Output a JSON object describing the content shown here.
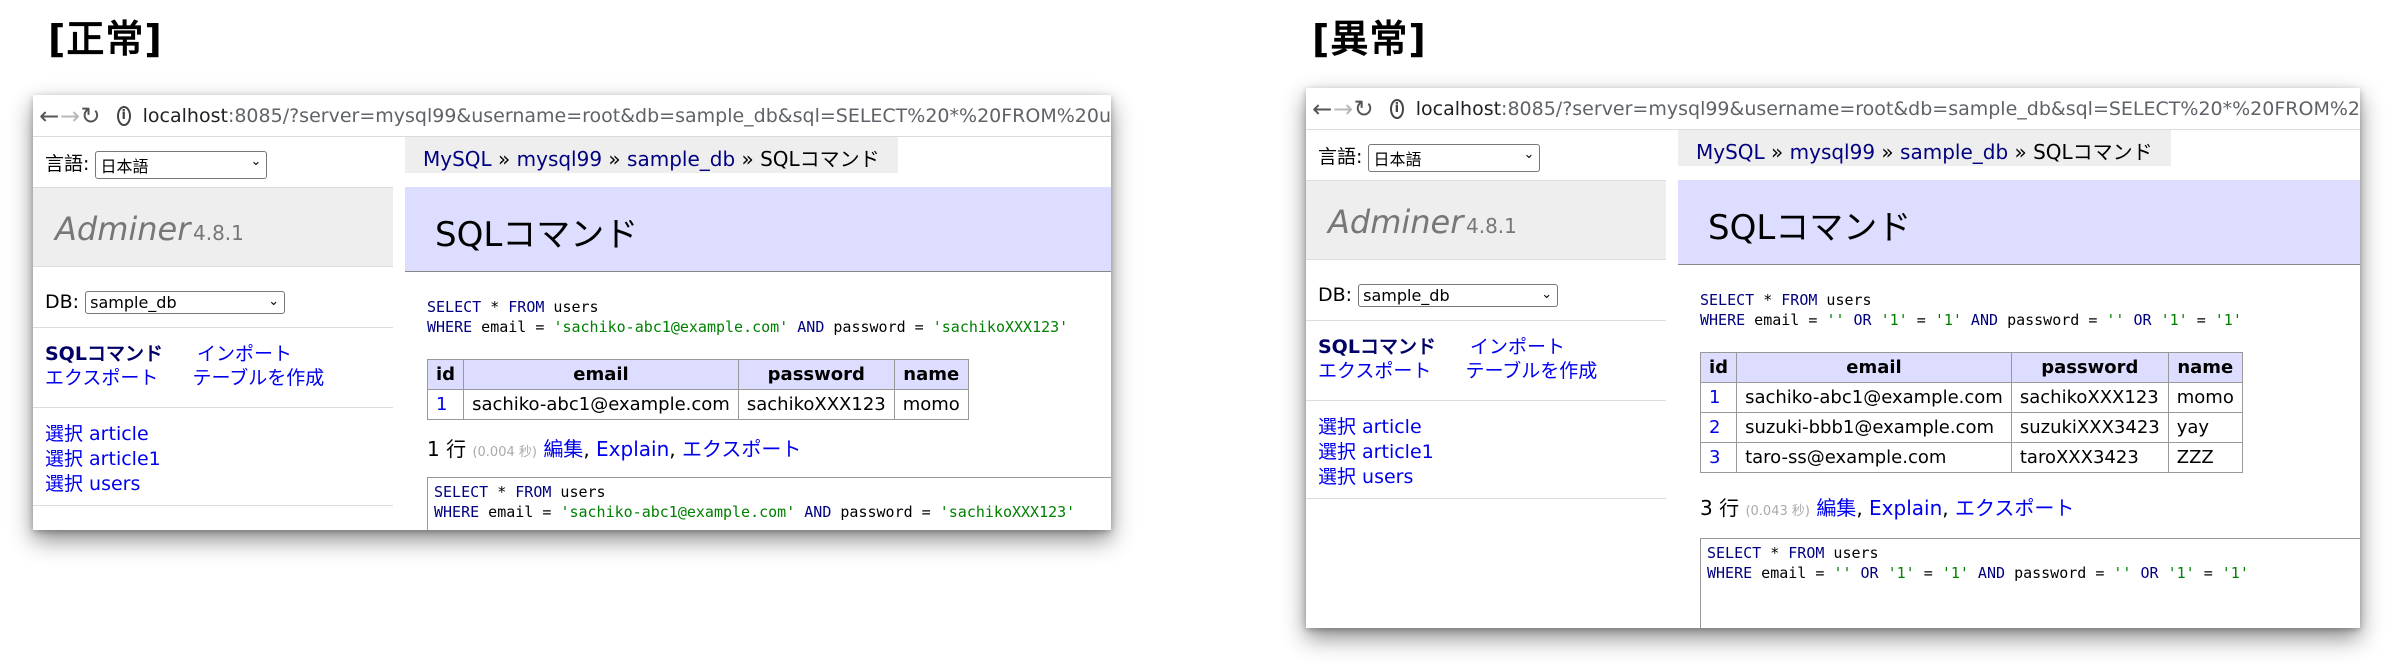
{
  "labels": {
    "normal": "[正常]",
    "abnormal": "[異常]"
  },
  "browser": {
    "back_icon": "arrow-left",
    "forward_icon": "arrow-right",
    "reload_icon": "reload",
    "info_icon": "info-circle",
    "url_host": "localhost",
    "url_rest_normal": ":8085/?server=mysql99&username=root&db=sample_db&sql=SELECT%20*%20FROM%20u",
    "url_rest_abnormal": ":8085/?server=mysql99&username=root&db=sample_db&sql=SELECT%20*%20FROM%2"
  },
  "sidebar": {
    "lang_label": "言語:",
    "lang_value": "日本語",
    "brand": "Adminer",
    "version": "4.8.1",
    "db_label": "DB:",
    "db_value": "sample_db",
    "links": {
      "sql": "SQLコマンド",
      "import": "インポート",
      "export": "エクスポート",
      "create_table": "テーブルを作成"
    },
    "tables": [
      "選択 article",
      "選択 article1",
      "選択 users"
    ]
  },
  "breadcrumb": {
    "mysql": "MySQL",
    "server": "mysql99",
    "db": "sample_db",
    "sep": " » ",
    "current": "SQLコマンド"
  },
  "page_title": "SQLコマンド",
  "normal": {
    "sql_kw1": "SELECT",
    "sql_star": " * ",
    "sql_from": "FROM",
    "sql_table": " users",
    "sql_where": "WHERE",
    "sql_email_eq": " email = ",
    "sql_email_val": "'sachiko-abc1@example.com'",
    "sql_and": " AND ",
    "sql_pw_eq": "password = ",
    "sql_pw_val": "'sachikoXXX123'",
    "columns": [
      "id",
      "email",
      "password",
      "name"
    ],
    "rows": [
      [
        "1",
        "sachiko-abc1@example.com",
        "sachikoXXX123",
        "momo"
      ]
    ],
    "count": "1 行",
    "time": "(0.004 秒)",
    "edit": "編集",
    "explain": "Explain",
    "export": "エクスポート"
  },
  "abnormal": {
    "sql_kw1": "SELECT",
    "sql_star": " * ",
    "sql_from": "FROM",
    "sql_table": " users",
    "sql_where": "WHERE",
    "sql_email_eq": " email = ",
    "sql_q1": "''",
    "sql_or1": " OR ",
    "sql_one_a": "'1'",
    "sql_eq": " = ",
    "sql_one_b": "'1'",
    "sql_and": " AND ",
    "sql_pw_eq": "password = ",
    "sql_q2": "''",
    "sql_or2": " OR ",
    "sql_one_c": "'1'",
    "sql_eq2": " = ",
    "sql_one_d": "'1'",
    "columns": [
      "id",
      "email",
      "password",
      "name"
    ],
    "rows": [
      [
        "1",
        "sachiko-abc1@example.com",
        "sachikoXXX123",
        "momo"
      ],
      [
        "2",
        "suzuki-bbb1@example.com",
        "suzukiXXX3423",
        "yay"
      ],
      [
        "3",
        "taro-ss@example.com",
        "taroXXX3423",
        "ZZZ"
      ]
    ],
    "count": "3 行",
    "time": "(0.043 秒)",
    "edit": "編集",
    "explain": "Explain",
    "export": "エクスポート"
  }
}
